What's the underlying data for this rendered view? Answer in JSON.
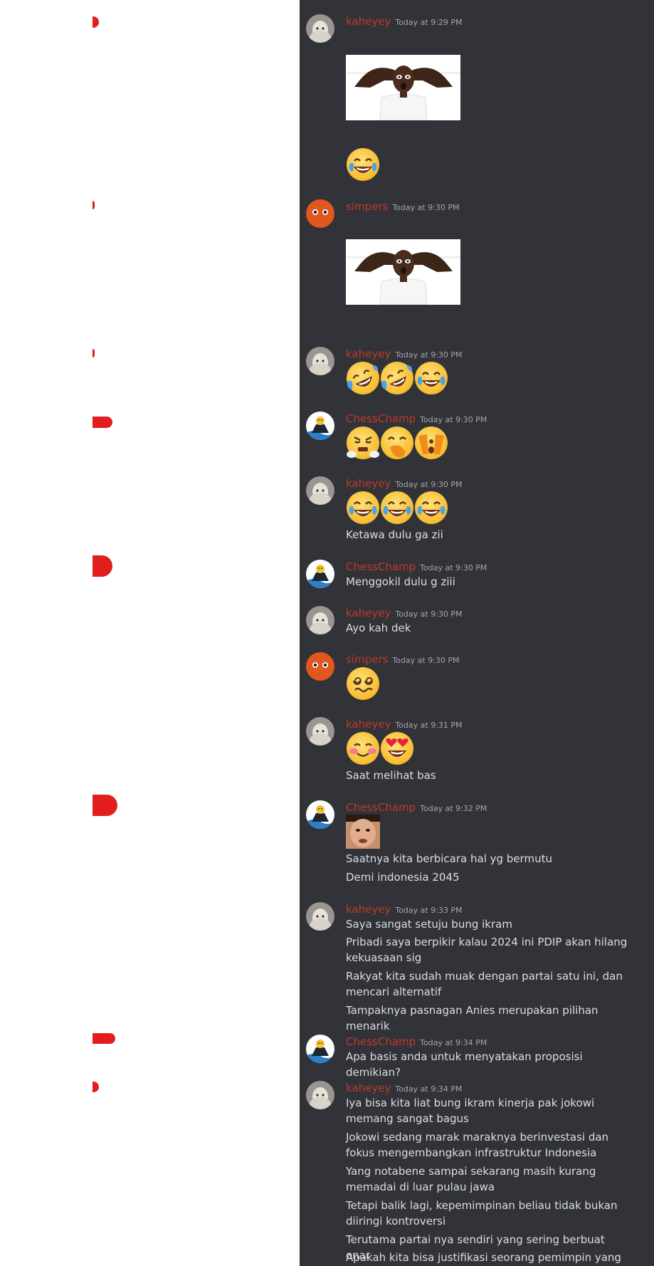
{
  "users": {
    "kaheyey": "kaheyey",
    "simpers": "simpers",
    "chesschamp": "ChessChamp"
  },
  "colors": {
    "chat_bg": "#313338",
    "username": "#c0392b",
    "timestamp": "#a3a6aa",
    "text": "#dbdee1",
    "marker": "#e11d1d"
  },
  "messages": [
    {
      "author": "kaheyey",
      "time": "Today at 9:29 PM",
      "content": [
        "sticker-shocked-man",
        "emoji-joy"
      ]
    },
    {
      "author": "simpers",
      "time": "Today at 9:30 PM",
      "content": [
        "sticker-shocked-man"
      ]
    },
    {
      "author": "kaheyey",
      "time": "Today at 9:30 PM",
      "content": [
        "emoji-rofl",
        "emoji-rofl",
        "emoji-joy"
      ]
    },
    {
      "author": "ChessChamp",
      "time": "Today at 9:30 PM",
      "content": [
        "emoji-triumph",
        "emoji-hand-over-mouth",
        "emoji-peeking"
      ]
    },
    {
      "author": "kaheyey",
      "time": "Today at 9:30 PM",
      "content": [
        "emoji-joy",
        "emoji-joy",
        "emoji-joy"
      ],
      "lines": [
        "Ketawa dulu ga zii"
      ]
    },
    {
      "author": "ChessChamp",
      "time": "Today at 9:30 PM",
      "lines": [
        "Menggokil dulu g ziii"
      ]
    },
    {
      "author": "kaheyey",
      "time": "Today at 9:30 PM",
      "lines": [
        "Ayo kah dek"
      ]
    },
    {
      "author": "simpers",
      "time": "Today at 9:30 PM",
      "content": [
        "emoji-woozy"
      ]
    },
    {
      "author": "kaheyey",
      "time": "Today at 9:31 PM",
      "content": [
        "emoji-blush",
        "emoji-heart-eyes"
      ],
      "lines": [
        "Saat melihat bas"
      ]
    },
    {
      "author": "ChessChamp",
      "time": "Today at 9:32 PM",
      "content": [
        "sticker-face"
      ],
      "lines": [
        "Saatnya kita berbicara hal yg bermutu",
        "Demi indonesia 2045"
      ]
    },
    {
      "author": "kaheyey",
      "time": "Today at 9:33 PM",
      "lines": [
        "Saya sangat setuju bung ikram",
        "Pribadi saya berpikir kalau 2024 ini PDIP akan hilang kekuasaan sig",
        "Rakyat kita sudah muak dengan partai satu ini, dan mencari alternatif",
        "Tampaknya pasnagan Anies merupakan pilihan menarik"
      ]
    },
    {
      "author": "ChessChamp",
      "time": "Today at 9:34 PM",
      "lines": [
        "Apa basis anda untuk menyatakan proposisi demikian?"
      ]
    },
    {
      "author": "kaheyey",
      "time": "Today at 9:34 PM",
      "lines": [
        "Iya bisa kita liat bung ikram kinerja pak jokowi memang sangat bagus",
        "Jokowi sedang marak maraknya berinvestasi dan fokus mengembangkan infrastruktur Indonesia",
        "Yang notabene sampai sekarang masih kurang memadai di luar pulau jawa",
        "Tetapi balik lagi, kepemimpinan beliau tidak bukan diiringi kontroversi",
        "Terutama partai nya sendiri yang sering berbuat onar",
        "Apakah kita bisa justifikasi seorang pemimpin yang"
      ]
    }
  ]
}
